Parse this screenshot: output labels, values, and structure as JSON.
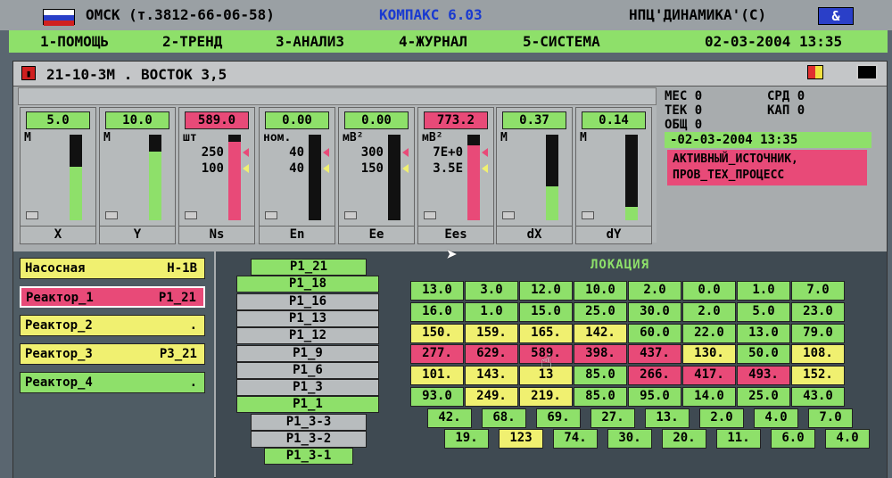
{
  "titlebar": {
    "location": "ОМСК (т.3812-66-06-58)",
    "app": "КОМПАКС 6.03",
    "vendor": "НПЦ'ДИНАМИКА'(С)",
    "amp": "&"
  },
  "menu": {
    "items": [
      "1-ПОМОЩЬ",
      "2-ТРЕНД",
      "3-АНАЛИЗ",
      "4-ЖУРНАЛ",
      "5-СИСТЕМА"
    ],
    "datetime": "02-03-2004 13:35"
  },
  "window": {
    "title": "21-10-3М . ВОСТОК 3,5"
  },
  "gauges": [
    {
      "value": "5.0",
      "unit": "М",
      "label": "X",
      "level": 0.62,
      "red": false,
      "bar": "#8ee06a"
    },
    {
      "value": "10.0",
      "unit": "М",
      "label": "Y",
      "level": 0.8,
      "red": false,
      "bar": "#8ee06a"
    },
    {
      "value": "589.0",
      "unit": "шт",
      "hi": "250",
      "lo": "100",
      "label": "Ns",
      "level": 0.92,
      "red": true,
      "bar": "#e84a78"
    },
    {
      "value": "0.00",
      "unit": "ном.",
      "hi": "40",
      "lo": "40",
      "label": "En",
      "level": 0.0,
      "red": false,
      "bar": "#8ee06a"
    },
    {
      "value": "0.00",
      "unit": "мВ²",
      "hi": "300",
      "lo": "150",
      "label": "Ee",
      "level": 0.0,
      "red": false,
      "bar": "#8ee06a"
    },
    {
      "value": "773.2",
      "unit": "мВ²",
      "hi": "7E+0",
      "lo": "3.5E",
      "label": "Ees",
      "level": 0.88,
      "red": true,
      "bar": "#e84a78"
    },
    {
      "value": "0.37",
      "unit": "М",
      "label": "dX",
      "level": 0.4,
      "red": false,
      "bar": "#8ee06a"
    },
    {
      "value": "0.14",
      "unit": "М",
      "label": "dY",
      "level": 0.16,
      "red": false,
      "bar": "#8ee06a"
    }
  ],
  "info": {
    "mes": "МЕС 0",
    "srd": "СРД 0",
    "tek": "ТЕК 0",
    "kap": "КАП 0",
    "obsh": "ОБЩ 0",
    "datetime": "-02-03-2004 13:35",
    "alarm1": "АКТИВНЫЙ_ИСТОЧНИК,",
    "alarm2": "ПРОВ_ТЕХ_ПРОЦЕСС"
  },
  "stations": [
    {
      "name": "Насосная",
      "tag": "Н-1В",
      "color": "#f0f070"
    },
    {
      "name": "Реактор_1",
      "tag": "Р1_21",
      "color": "#e84a78"
    },
    {
      "name": "Реактор_2",
      "tag": ".",
      "color": "#f0f070"
    },
    {
      "name": "Реактор_3",
      "tag": "Р3_21",
      "color": "#f0f070"
    },
    {
      "name": "Реактор_4",
      "tag": ".",
      "color": "#8ee06a"
    }
  ],
  "points": [
    {
      "label": "Р1_21",
      "color": "#8ee06a"
    },
    {
      "label": "Р1_18",
      "color": "#8ee06a"
    },
    {
      "label": "Р1_16",
      "color": "#b8bcbe"
    },
    {
      "label": "Р1_13",
      "color": "#b8bcbe"
    },
    {
      "label": "Р1_12",
      "color": "#b8bcbe"
    },
    {
      "label": "Р1_9",
      "color": "#b8bcbe"
    },
    {
      "label": "Р1_6",
      "color": "#b8bcbe"
    },
    {
      "label": "Р1_3",
      "color": "#b8bcbe"
    },
    {
      "label": "Р1_1",
      "color": "#8ee06a"
    },
    {
      "label": "Р1_3-3",
      "color": "#b8bcbe"
    },
    {
      "label": "Р1_3-2",
      "color": "#b8bcbe"
    },
    {
      "label": "Р1_3-1",
      "color": "#8ee06a"
    }
  ],
  "location": {
    "title": "ЛОКАЦИЯ",
    "rows": [
      [
        {
          "v": "13.0",
          "c": "g"
        },
        {
          "v": "3.0",
          "c": "g"
        },
        {
          "v": "12.0",
          "c": "g"
        },
        {
          "v": "10.0",
          "c": "g"
        },
        {
          "v": "2.0",
          "c": "g"
        },
        {
          "v": "0.0",
          "c": "g"
        },
        {
          "v": "1.0",
          "c": "g"
        },
        {
          "v": "7.0",
          "c": "g"
        }
      ],
      [
        {
          "v": "16.0",
          "c": "g"
        },
        {
          "v": "1.0",
          "c": "g"
        },
        {
          "v": "15.0",
          "c": "g"
        },
        {
          "v": "25.0",
          "c": "g"
        },
        {
          "v": "30.0",
          "c": "g"
        },
        {
          "v": "2.0",
          "c": "g"
        },
        {
          "v": "5.0",
          "c": "g"
        },
        {
          "v": "23.0",
          "c": "g"
        }
      ],
      [
        {
          "v": "150.",
          "c": "y"
        },
        {
          "v": "159.",
          "c": "y"
        },
        {
          "v": "165.",
          "c": "y"
        },
        {
          "v": "142.",
          "c": "y"
        },
        {
          "v": "60.0",
          "c": "g"
        },
        {
          "v": "22.0",
          "c": "g"
        },
        {
          "v": "13.0",
          "c": "g"
        },
        {
          "v": "79.0",
          "c": "g"
        }
      ],
      [
        {
          "v": "277.",
          "c": "r"
        },
        {
          "v": "629.",
          "c": "r"
        },
        {
          "v": "589.",
          "c": "r"
        },
        {
          "v": "398.",
          "c": "r"
        },
        {
          "v": "437.",
          "c": "r"
        },
        {
          "v": "130.",
          "c": "y"
        },
        {
          "v": "50.0",
          "c": "g"
        },
        {
          "v": "108.",
          "c": "y"
        }
      ],
      [
        {
          "v": "101.",
          "c": "y"
        },
        {
          "v": "143.",
          "c": "y"
        },
        {
          "v": "13",
          "c": "y"
        },
        {
          "v": "85.0",
          "c": "g"
        },
        {
          "v": "266.",
          "c": "r"
        },
        {
          "v": "417.",
          "c": "r"
        },
        {
          "v": "493.",
          "c": "r"
        },
        {
          "v": "152.",
          "c": "y"
        }
      ],
      [
        {
          "v": "93.0",
          "c": "g"
        },
        {
          "v": "249.",
          "c": "y"
        },
        {
          "v": "219.",
          "c": "y"
        },
        {
          "v": "85.0",
          "c": "g"
        },
        {
          "v": "95.0",
          "c": "g"
        },
        {
          "v": "14.0",
          "c": "g"
        },
        {
          "v": "25.0",
          "c": "g"
        },
        {
          "v": "43.0",
          "c": "g"
        }
      ],
      [
        {
          "v": "42.",
          "c": "g"
        },
        {
          "v": "68.",
          "c": "g"
        },
        {
          "v": "69.",
          "c": "g"
        },
        {
          "v": "27.",
          "c": "g"
        },
        {
          "v": "13.",
          "c": "g"
        },
        {
          "v": "2.0",
          "c": "g"
        },
        {
          "v": "4.0",
          "c": "g"
        },
        {
          "v": "7.0",
          "c": "g"
        }
      ],
      [
        {
          "v": "19.",
          "c": "g"
        },
        {
          "v": "123",
          "c": "y"
        },
        {
          "v": "74.",
          "c": "g"
        },
        {
          "v": "30.",
          "c": "g"
        },
        {
          "v": "20.",
          "c": "g"
        },
        {
          "v": "11.",
          "c": "g"
        },
        {
          "v": "6.0",
          "c": "g"
        },
        {
          "v": "4.0",
          "c": "g"
        }
      ]
    ]
  }
}
